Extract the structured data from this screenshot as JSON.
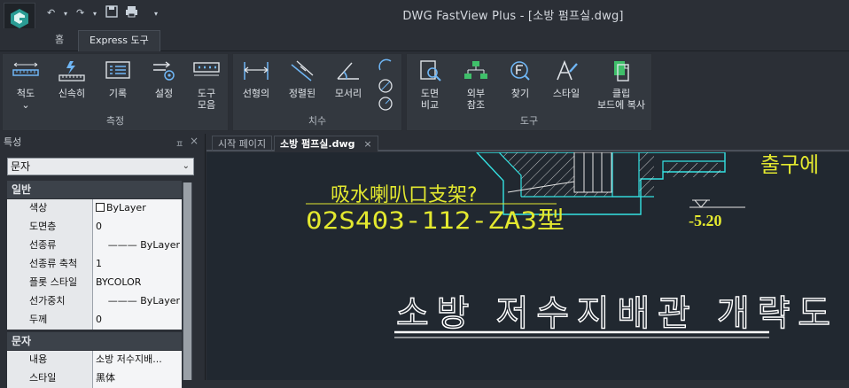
{
  "app": {
    "title": "DWG FastView Plus - [소방 펌프실.dwg]"
  },
  "quick_access": {
    "undo": "↶",
    "redo": "↷",
    "dropdown": "▾",
    "save": "💾",
    "print": "⎙",
    "customize": "▾"
  },
  "ribbon_tabs": [
    {
      "label": "홈"
    },
    {
      "label": "Express 도구"
    }
  ],
  "ribbon": {
    "groups": [
      {
        "label": "측정",
        "buttons": [
          {
            "label": "척도",
            "sub": "⌄"
          },
          {
            "label": "신속히"
          },
          {
            "label": "기록"
          },
          {
            "label": "설정"
          },
          {
            "label": "도구\n모음"
          }
        ]
      },
      {
        "label": "치수",
        "buttons": [
          {
            "label": "선형의"
          },
          {
            "label": "정렬된"
          },
          {
            "label": "모서리"
          }
        ]
      },
      {
        "label": "도구",
        "buttons": [
          {
            "label": "도면\n비교"
          },
          {
            "label": "외부\n참조"
          },
          {
            "label": "찾기"
          },
          {
            "label": "스타일"
          },
          {
            "label": "클립\n보드에 복사"
          }
        ]
      }
    ]
  },
  "properties": {
    "title": "특성",
    "pin": "ㅍ",
    "close": "×",
    "selected_type": "문자",
    "sections": [
      {
        "label": "일반",
        "rows": [
          {
            "key": "색상",
            "value": "ByLayer"
          },
          {
            "key": "도면층",
            "value": "0"
          },
          {
            "key": "선종류",
            "value": "——— ByLayer"
          },
          {
            "key": "선종류 축척",
            "value": "1"
          },
          {
            "key": "플롯 스타일",
            "value": "BYCOLOR"
          },
          {
            "key": "선가중치",
            "value": "——— ByLayer"
          },
          {
            "key": "두께",
            "value": "0"
          }
        ]
      },
      {
        "label": "문자",
        "rows": [
          {
            "key": "내용",
            "value": "소방 저수지배..."
          },
          {
            "key": "스타일",
            "value": "黑体"
          }
        ]
      }
    ]
  },
  "doc_tabs": [
    {
      "label": "시작 페이지"
    },
    {
      "label": "소방 펌프실.dwg",
      "close": "×"
    }
  ],
  "drawing": {
    "text_chinese": "吸水喇叭口支架?",
    "text_code": "02S403-112-ZA3型",
    "elevation": "-5.20",
    "text_outlet": "출구에",
    "title_text": "소방 저수지배관 개략도"
  },
  "colors": {
    "accent_cyan": "#34e3e3",
    "cad_yellow": "#e3e82f",
    "cad_white": "#ffffff"
  }
}
